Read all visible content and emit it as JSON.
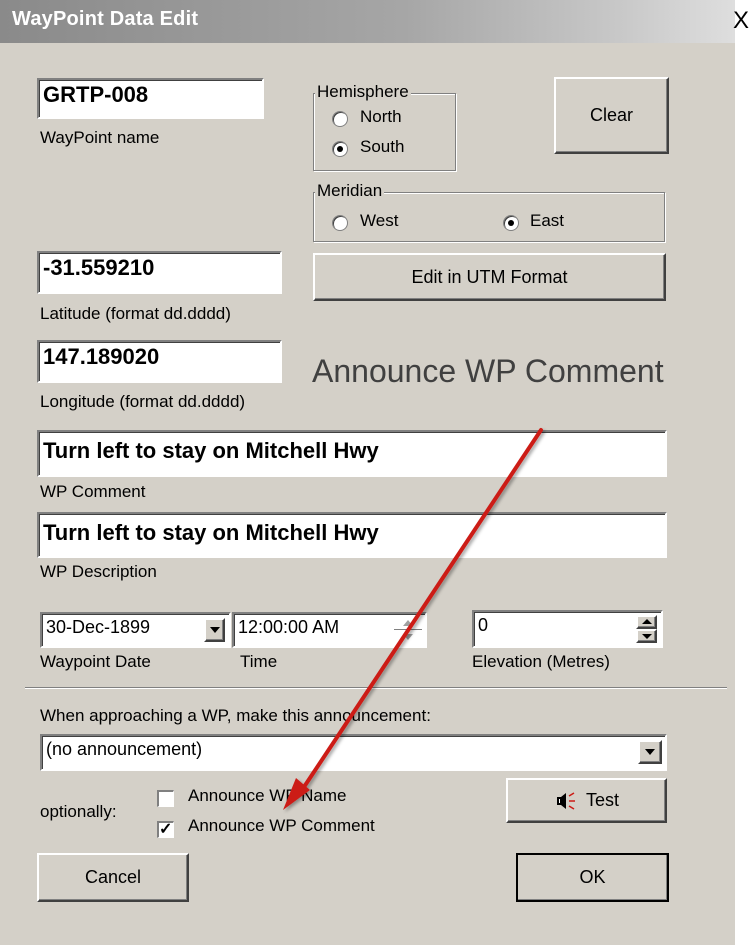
{
  "window": {
    "title": "WayPoint Data Edit",
    "close_glyph": "X"
  },
  "name_field": {
    "value": "GRTP-008",
    "label": "WayPoint name"
  },
  "hemisphere": {
    "legend": "Hemisphere",
    "options": [
      "North",
      "South"
    ],
    "selected": "South"
  },
  "meridian": {
    "legend": "Meridian",
    "options": [
      "West",
      "East"
    ],
    "selected": "East"
  },
  "clear_button": "Clear",
  "utm_button": "Edit in UTM Format",
  "latitude": {
    "value": "-31.559210",
    "label": "Latitude (format dd.dddd)"
  },
  "longitude": {
    "value": "147.189020",
    "label": "Longitude (format dd.dddd)"
  },
  "comment": {
    "value": "Turn left to stay on Mitchell Hwy",
    "label": "WP Comment"
  },
  "description": {
    "value": "Turn left to stay on Mitchell Hwy",
    "label": "WP Description"
  },
  "date": {
    "value": "30-Dec-1899",
    "label": "Waypoint Date"
  },
  "time": {
    "value": "12:00:00 AM",
    "label": "Time"
  },
  "elevation": {
    "value": "0",
    "label": "Elevation (Metres)"
  },
  "announce": {
    "prompt": "When approaching a WP, make this announcement:",
    "selected": "(no announcement)",
    "optionally_label": "optionally:",
    "name_option": {
      "label": "Announce WP Name",
      "checked": false
    },
    "comment_option": {
      "label": "Announce WP Comment",
      "checked": true
    }
  },
  "test_button": "Test",
  "cancel_button": "Cancel",
  "ok_button": "OK",
  "annotation": {
    "text": "Announce WP Comment",
    "arrow_color": "#cc1a14"
  },
  "icons": {
    "close": "close-icon",
    "speaker": "speaker-icon",
    "dropdown": "chevron-down-icon",
    "spin": "spin-arrows-icon"
  },
  "colors": {
    "dialog_bg": "#d4d0c8",
    "arrow": "#cc1a14"
  }
}
